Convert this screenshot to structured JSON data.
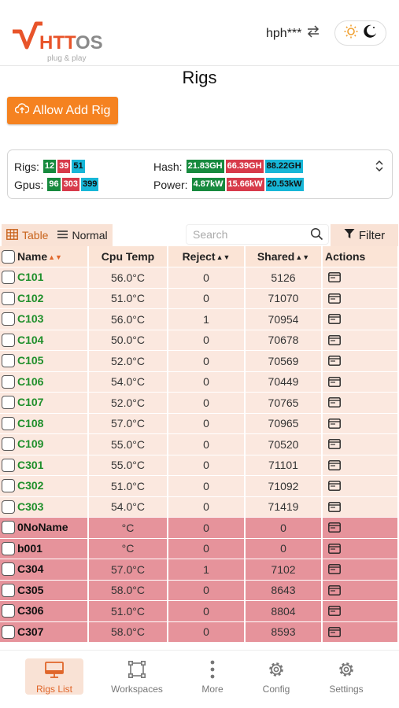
{
  "header": {
    "logo_text": "HTTOS",
    "logo_tagline": "plug & play",
    "username": "hph***",
    "swap_icon": "swap-arrows-icon",
    "theme_icons": [
      "sun-icon",
      "moon-icon"
    ]
  },
  "page": {
    "title": "Rigs"
  },
  "toolbar": {
    "allow_add_rig_label": "Allow Add Rig"
  },
  "summary": {
    "rigs_label": "Rigs:",
    "rigs": {
      "green": "12",
      "red": "39",
      "cyan": "51"
    },
    "gpus_label": "Gpus:",
    "gpus": {
      "green": "96",
      "red": "303",
      "cyan": "399"
    },
    "hash_label": "Hash:",
    "hash": {
      "green": "21.83GH",
      "red": "66.39GH",
      "cyan": "88.22GH"
    },
    "power_label": "Power:",
    "power": {
      "green": "4.87kW",
      "red": "15.66kW",
      "cyan": "20.53kW"
    }
  },
  "view": {
    "table_label": "Table",
    "normal_label": "Normal",
    "search_placeholder": "Search",
    "filter_label": "Filter"
  },
  "table": {
    "columns": [
      "Name",
      "Cpu Temp",
      "Reject",
      "Shared",
      "Actions"
    ],
    "rows": [
      {
        "name": "C101",
        "cpu_temp": "56.0°C",
        "reject": "0",
        "shared": "5126",
        "status": "ok"
      },
      {
        "name": "C102",
        "cpu_temp": "51.0°C",
        "reject": "0",
        "shared": "71070",
        "status": "ok"
      },
      {
        "name": "C103",
        "cpu_temp": "56.0°C",
        "reject": "1",
        "shared": "70954",
        "status": "ok"
      },
      {
        "name": "C104",
        "cpu_temp": "50.0°C",
        "reject": "0",
        "shared": "70678",
        "status": "ok"
      },
      {
        "name": "C105",
        "cpu_temp": "52.0°C",
        "reject": "0",
        "shared": "70569",
        "status": "ok"
      },
      {
        "name": "C106",
        "cpu_temp": "54.0°C",
        "reject": "0",
        "shared": "70449",
        "status": "ok"
      },
      {
        "name": "C107",
        "cpu_temp": "52.0°C",
        "reject": "0",
        "shared": "70765",
        "status": "ok"
      },
      {
        "name": "C108",
        "cpu_temp": "57.0°C",
        "reject": "0",
        "shared": "70965",
        "status": "ok"
      },
      {
        "name": "C109",
        "cpu_temp": "55.0°C",
        "reject": "0",
        "shared": "70520",
        "status": "ok"
      },
      {
        "name": "C301",
        "cpu_temp": "55.0°C",
        "reject": "0",
        "shared": "71101",
        "status": "ok"
      },
      {
        "name": "C302",
        "cpu_temp": "51.0°C",
        "reject": "0",
        "shared": "71092",
        "status": "ok"
      },
      {
        "name": "C303",
        "cpu_temp": "54.0°C",
        "reject": "0",
        "shared": "71419",
        "status": "ok"
      },
      {
        "name": "0NoName",
        "cpu_temp": "°C",
        "reject": "0",
        "shared": "0",
        "status": "bad"
      },
      {
        "name": "b001",
        "cpu_temp": "°C",
        "reject": "0",
        "shared": "0",
        "status": "bad"
      },
      {
        "name": "C304",
        "cpu_temp": "57.0°C",
        "reject": "1",
        "shared": "7102",
        "status": "bad"
      },
      {
        "name": "C305",
        "cpu_temp": "58.0°C",
        "reject": "0",
        "shared": "8643",
        "status": "bad"
      },
      {
        "name": "C306",
        "cpu_temp": "51.0°C",
        "reject": "0",
        "shared": "8804",
        "status": "bad"
      },
      {
        "name": "C307",
        "cpu_temp": "58.0°C",
        "reject": "0",
        "shared": "8593",
        "status": "bad"
      }
    ]
  },
  "bottom_nav": [
    {
      "label": "Rigs List",
      "icon": "monitor-icon",
      "active": true
    },
    {
      "label": "Workspaces",
      "icon": "workspaces-icon",
      "active": false
    },
    {
      "label": "More",
      "icon": "more-dots-icon",
      "active": false
    },
    {
      "label": "Config",
      "icon": "gear-icon",
      "active": false
    },
    {
      "label": "Settings",
      "icon": "settings-icon",
      "active": false
    }
  ],
  "colors": {
    "accent": "#f58220",
    "ok_row": "#fbe8df",
    "error_row": "#e6939b",
    "badge_green": "#178a3e",
    "badge_red": "#d73a4a",
    "badge_cyan": "#17b6d7"
  }
}
